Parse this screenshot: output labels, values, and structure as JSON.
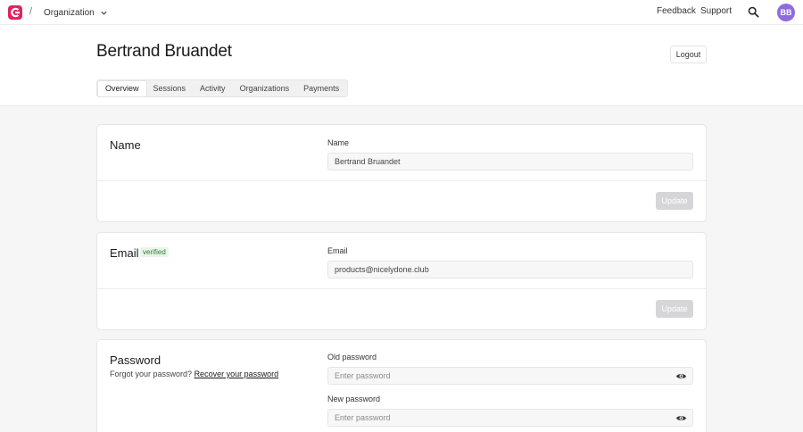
{
  "topbar": {
    "breadcrumb_sep": "/",
    "org_selector": "Organization",
    "feedback": "Feedback",
    "support": "Support",
    "avatar_initials": "BB"
  },
  "header": {
    "title": "Bertrand Bruandet",
    "logout": "Logout",
    "tabs": [
      {
        "label": "Overview",
        "active": true
      },
      {
        "label": "Sessions"
      },
      {
        "label": "Activity"
      },
      {
        "label": "Organizations"
      },
      {
        "label": "Payments"
      }
    ]
  },
  "name_card": {
    "title": "Name",
    "field_label": "Name",
    "field_value": "Bertrand Bruandet",
    "update": "Update"
  },
  "email_card": {
    "title": "Email",
    "badge": "verified",
    "field_label": "Email",
    "field_value": "products@nicelydone.club",
    "update": "Update"
  },
  "password_card": {
    "title": "Password",
    "forgot_text": "Forgot your password?",
    "recover_link": "Recover your password",
    "old_label": "Old password",
    "old_placeholder": "Enter password",
    "new_label": "New password",
    "new_placeholder": "Enter password"
  },
  "colors": {
    "brand": "#e0245e",
    "avatar": "#8e6cdb",
    "badge_text": "#2f7d32",
    "badge_bg": "#eaf5ea"
  },
  "icons": {
    "logo": "brand-logo-icon",
    "dropdown": "chevron-down-icon",
    "search": "search-icon",
    "reveal": "eye-icon"
  }
}
